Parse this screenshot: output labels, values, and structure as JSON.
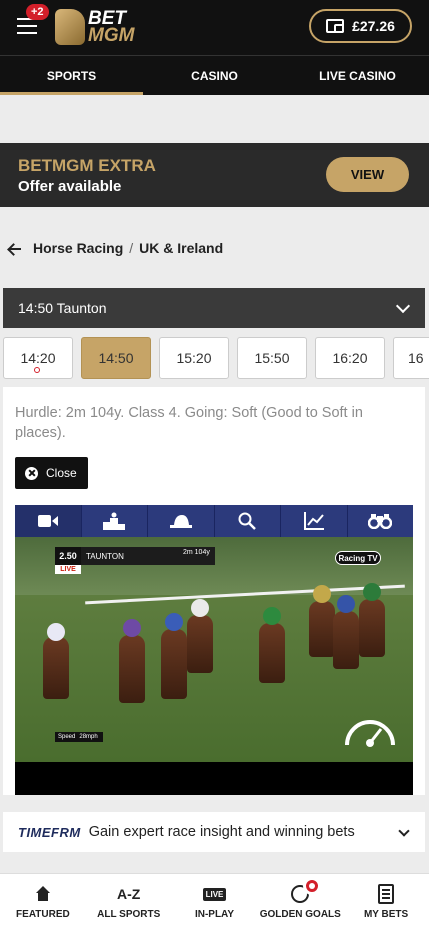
{
  "header": {
    "notification_count": "+2",
    "logo_line1": "BET",
    "logo_line2": "MGM",
    "balance": "£27.26"
  },
  "nav_tabs": [
    {
      "label": "SPORTS",
      "active": true
    },
    {
      "label": "CASINO",
      "active": false
    },
    {
      "label": "LIVE CASINO",
      "active": false
    }
  ],
  "promo": {
    "title": "BETMGM EXTRA",
    "subtitle": "Offer available",
    "button": "VIEW"
  },
  "breadcrumb": {
    "parent": "Horse Racing",
    "separator": "/",
    "current": "UK & Ireland"
  },
  "race_select": {
    "value": "14:50 Taunton"
  },
  "race_times": [
    "14:20",
    "14:50",
    "15:20",
    "15:50",
    "16:20",
    "16"
  ],
  "race_info": "Hurdle: 2m 104y. Class 4. Going: Soft (Good to Soft in places).",
  "close_button": "Close",
  "media_tabs": [
    "video-camera-icon",
    "podium-icon",
    "jockey-cap-icon",
    "search-icon",
    "chart-icon",
    "binoculars-icon"
  ],
  "video": {
    "race_time": "2.50",
    "course": "TAUNTON",
    "distance": "2m 104y",
    "live_label": "LIVE",
    "channel": "Racing TV",
    "speed_label": "Speed",
    "speed_value": "28mph"
  },
  "timeform": {
    "logo": "TIMEFRM",
    "text": "Gain expert race insight and winning bets"
  },
  "bottom_nav": [
    {
      "label": "FEATURED",
      "icon": "home-icon"
    },
    {
      "label": "ALL SPORTS",
      "icon": "az-icon",
      "icon_text": "A-Z"
    },
    {
      "label": "IN-PLAY",
      "icon": "live-icon",
      "icon_text": "LIVE"
    },
    {
      "label": "GOLDEN GOALS",
      "icon": "football-icon"
    },
    {
      "label": "MY BETS",
      "icon": "betslip-icon"
    }
  ],
  "colors": {
    "brand_gold": "#c6a467",
    "header_bg": "#111111",
    "alert_red": "#d31f2a",
    "media_tab_bg": "#2c3a7c"
  }
}
